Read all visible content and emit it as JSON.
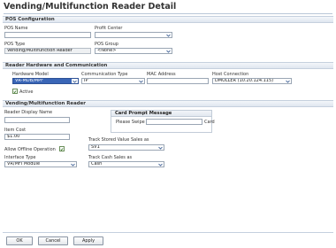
{
  "page": {
    "title": "Vending/Multifunction Reader Detail"
  },
  "pos_config": {
    "header": "POS Configuration",
    "pos_name_label": "POS Name",
    "pos_name_value": "",
    "profit_center_label": "Profit Center",
    "profit_center_value": "",
    "pos_type_label": "POS Type",
    "pos_type_value": "Vending/Multifunction Reader",
    "pos_group_label": "POS Group",
    "pos_group_value": "<None>"
  },
  "hardware": {
    "header": "Reader Hardware and Communication",
    "hardware_model_label": "Hardware Model",
    "hardware_model_value": "VR-MDB/MPF",
    "comm_type_label": "Communication Type",
    "comm_type_value": "IP",
    "mac_label": "MAC Address",
    "mac_value": "",
    "host_conn_label": "Host Connection",
    "host_conn_value": "DMULLER (10.20.124.115)",
    "active_label": "Active",
    "active_checked": true
  },
  "reader": {
    "header": "Vending/Multifunction Reader",
    "display_name_label": "Reader Display Name",
    "display_name_value": "",
    "item_cost_label": "Item Cost",
    "item_cost_value": "$1.00",
    "offline_label": "Allow Offline Operation",
    "offline_checked": true,
    "interface_label": "Interface Type",
    "interface_value": "VR/MFI Module",
    "card_prompt_header": "Card Prompt Message",
    "card_prompt_prefix": "Please Swipe",
    "card_prompt_value": "",
    "card_prompt_suffix": "Card",
    "stored_value_label": "Track Stored Value Sales as",
    "stored_value_value": "SV1",
    "cash_sales_label": "Track Cash Sales as",
    "cash_sales_value": "Cash"
  },
  "footer": {
    "ok_label": "OK",
    "cancel_label": "Cancel",
    "apply_label": "Apply"
  }
}
